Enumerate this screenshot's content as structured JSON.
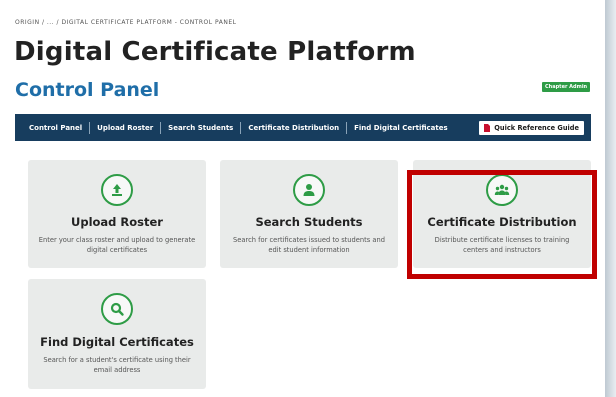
{
  "breadcrumb": "ORIGIN / ... / DIGITAL CERTIFICATE PLATFORM - CONTROL PANEL",
  "page_title": "Digital Certificate Platform",
  "subtitle": "Control Panel",
  "role_badge": "Chapter Admin",
  "nav": {
    "items": [
      "Control Panel",
      "Upload Roster",
      "Search Students",
      "Certificate Distribution",
      "Find Digital Certificates"
    ],
    "quick_ref_label": "Quick Reference Guide"
  },
  "cards": [
    {
      "title": "Upload Roster",
      "desc": "Enter your class roster and upload to generate digital certificates",
      "icon": "upload-icon"
    },
    {
      "title": "Search Students",
      "desc": "Search for certificates issued to students and edit student information",
      "icon": "person-icon"
    },
    {
      "title": "Certificate Distribution",
      "desc": "Distribute certificate licenses to training centers and instructors",
      "icon": "group-icon"
    },
    {
      "title": "Find Digital Certificates",
      "desc": "Search for a student's certificate using their email address",
      "icon": "search-icon"
    }
  ],
  "colors": {
    "accent_green": "#2e9c46",
    "nav_blue": "#173d5e",
    "title_blue": "#1f6ea8",
    "highlight_red": "#c00000"
  }
}
